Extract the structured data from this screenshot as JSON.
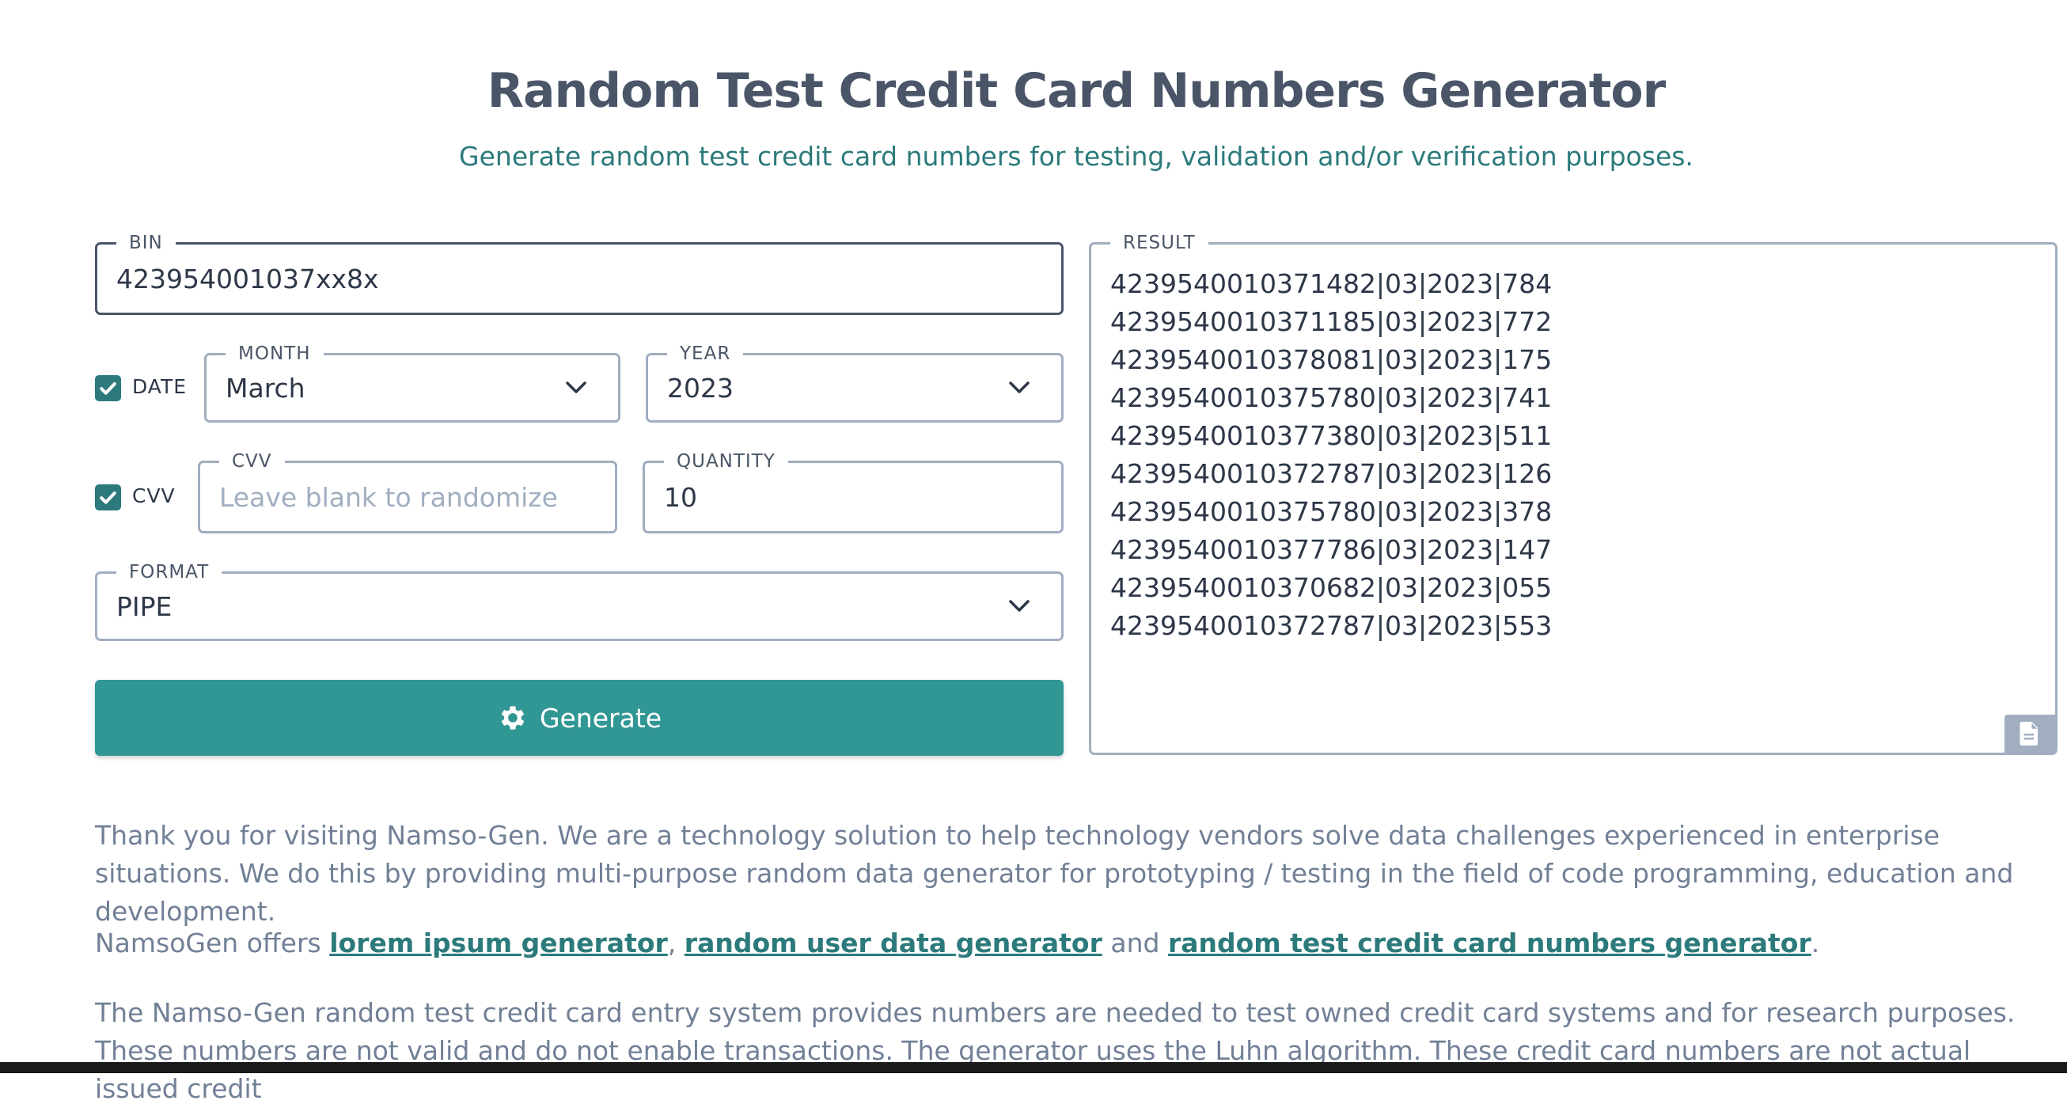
{
  "page": {
    "title": "Random Test Credit Card Numbers Generator",
    "subtitle": "Generate random test credit card numbers for testing, validation and/or verification purposes."
  },
  "form": {
    "bin": {
      "label": "BIN",
      "value": "423954001037xx8x"
    },
    "date": {
      "checkbox_label": "DATE",
      "checked": true
    },
    "month": {
      "label": "MONTH",
      "value": "March"
    },
    "year": {
      "label": "YEAR",
      "value": "2023"
    },
    "cvv": {
      "checkbox_label": "CVV",
      "checked": true,
      "label": "CVV",
      "placeholder": "Leave blank to randomize",
      "value": ""
    },
    "quantity": {
      "label": "QUANTITY",
      "value": "10"
    },
    "format": {
      "label": "FORMAT",
      "value": "PIPE"
    },
    "generate_label": "Generate"
  },
  "result": {
    "label": "RESULT",
    "lines": [
      "4239540010371482|03|2023|784",
      "4239540010371185|03|2023|772",
      "4239540010378081|03|2023|175",
      "4239540010375780|03|2023|741",
      "4239540010377380|03|2023|511",
      "4239540010372787|03|2023|126",
      "4239540010375780|03|2023|378",
      "4239540010377786|03|2023|147",
      "4239540010370682|03|2023|055",
      "4239540010372787|03|2023|553"
    ]
  },
  "info": {
    "p1": "Thank you for visiting Namso-Gen. We are a technology solution to help technology vendors solve data challenges experienced in enterprise situations. We do this by providing multi-purpose random data generator for prototyping / testing in the field of code programming, education and development.",
    "p2_prefix": "NamsoGen offers ",
    "link_lorem": "lorem ipsum generator",
    "p2_comma": ", ",
    "link_user": "random user data generator",
    "p2_and": " and ",
    "link_cc": "random test credit card numbers generator",
    "p2_end": ".",
    "p3": "The Namso-Gen random test credit card entry system provides numbers are needed to test owned credit card systems and for research purposes. These numbers are not valid and do not enable transactions. The generator uses the Luhn algorithm. These credit card numbers are not actual issued credit"
  },
  "colors": {
    "accent": "#319795",
    "accent_text": "#2c7a7b",
    "heading": "#4a5568",
    "border": "#a0aec0"
  }
}
